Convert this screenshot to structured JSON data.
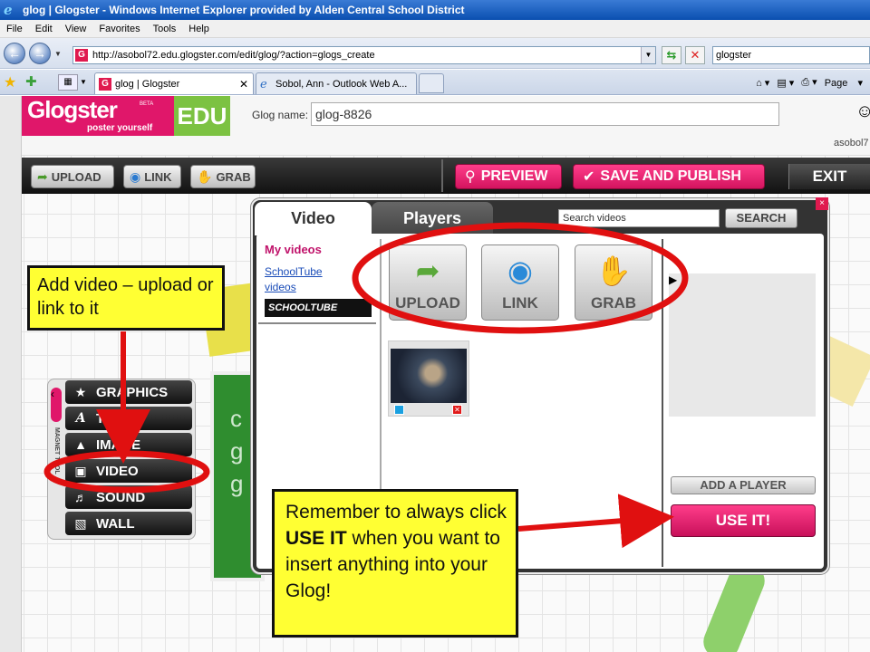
{
  "window": {
    "title": "glog | Glogster - Windows Internet Explorer provided by Alden Central School District"
  },
  "menu": [
    "File",
    "Edit",
    "View",
    "Favorites",
    "Tools",
    "Help"
  ],
  "address": {
    "url": "http://asobol72.edu.glogster.com/edit/glog/?action=glogs_create",
    "search_value": "glogster"
  },
  "tabs": [
    {
      "label": "glog | Glogster",
      "active": true
    },
    {
      "label": "Sobol, Ann - Outlook Web A...",
      "active": false
    }
  ],
  "commandbar": {
    "page_label": "Page"
  },
  "glogster": {
    "logo_name": "Glogster",
    "logo_beta": "BETA",
    "logo_tagline": "poster yourself",
    "logo_edu": "EDU",
    "glog_name_label": "Glog name:",
    "glog_name_value": "glog-8826",
    "username": "asobol7"
  },
  "toolbar": {
    "upload": "UPLOAD",
    "link": "LINK",
    "grab": "GRAB",
    "preview": "PREVIEW",
    "save_publish": "SAVE AND PUBLISH",
    "exit": "EXIT"
  },
  "palette": {
    "label": "MAGNET TOOL",
    "items": [
      "GRAPHICS",
      "TEXT",
      "IMAGE",
      "VIDEO",
      "SOUND",
      "WALL"
    ]
  },
  "modal": {
    "tabs": [
      "Video",
      "Players"
    ],
    "search_placeholder": "Search videos",
    "search_button": "SEARCH",
    "close": "×",
    "my_videos": "My videos",
    "schooltube_link": "SchoolTube videos",
    "schooltube_logo": "SCHOOLTUBE",
    "buttons": [
      "UPLOAD",
      "LINK",
      "GRAB"
    ],
    "add_player": "ADD A PLAYER",
    "use_it": "USE IT!"
  },
  "annotations": {
    "callout1": "Add video – upload or link to it",
    "callout2_pre": "Remember to always click ",
    "callout2_bold": "USE IT",
    "callout2_post": " when you want to insert anything into your Glog!"
  },
  "background_letters": "c g g f",
  "colors": {
    "accent_pink": "#e0176a",
    "edu_green": "#7cc242",
    "callout_yellow": "#ffff33",
    "annotation_red": "#e01010"
  }
}
